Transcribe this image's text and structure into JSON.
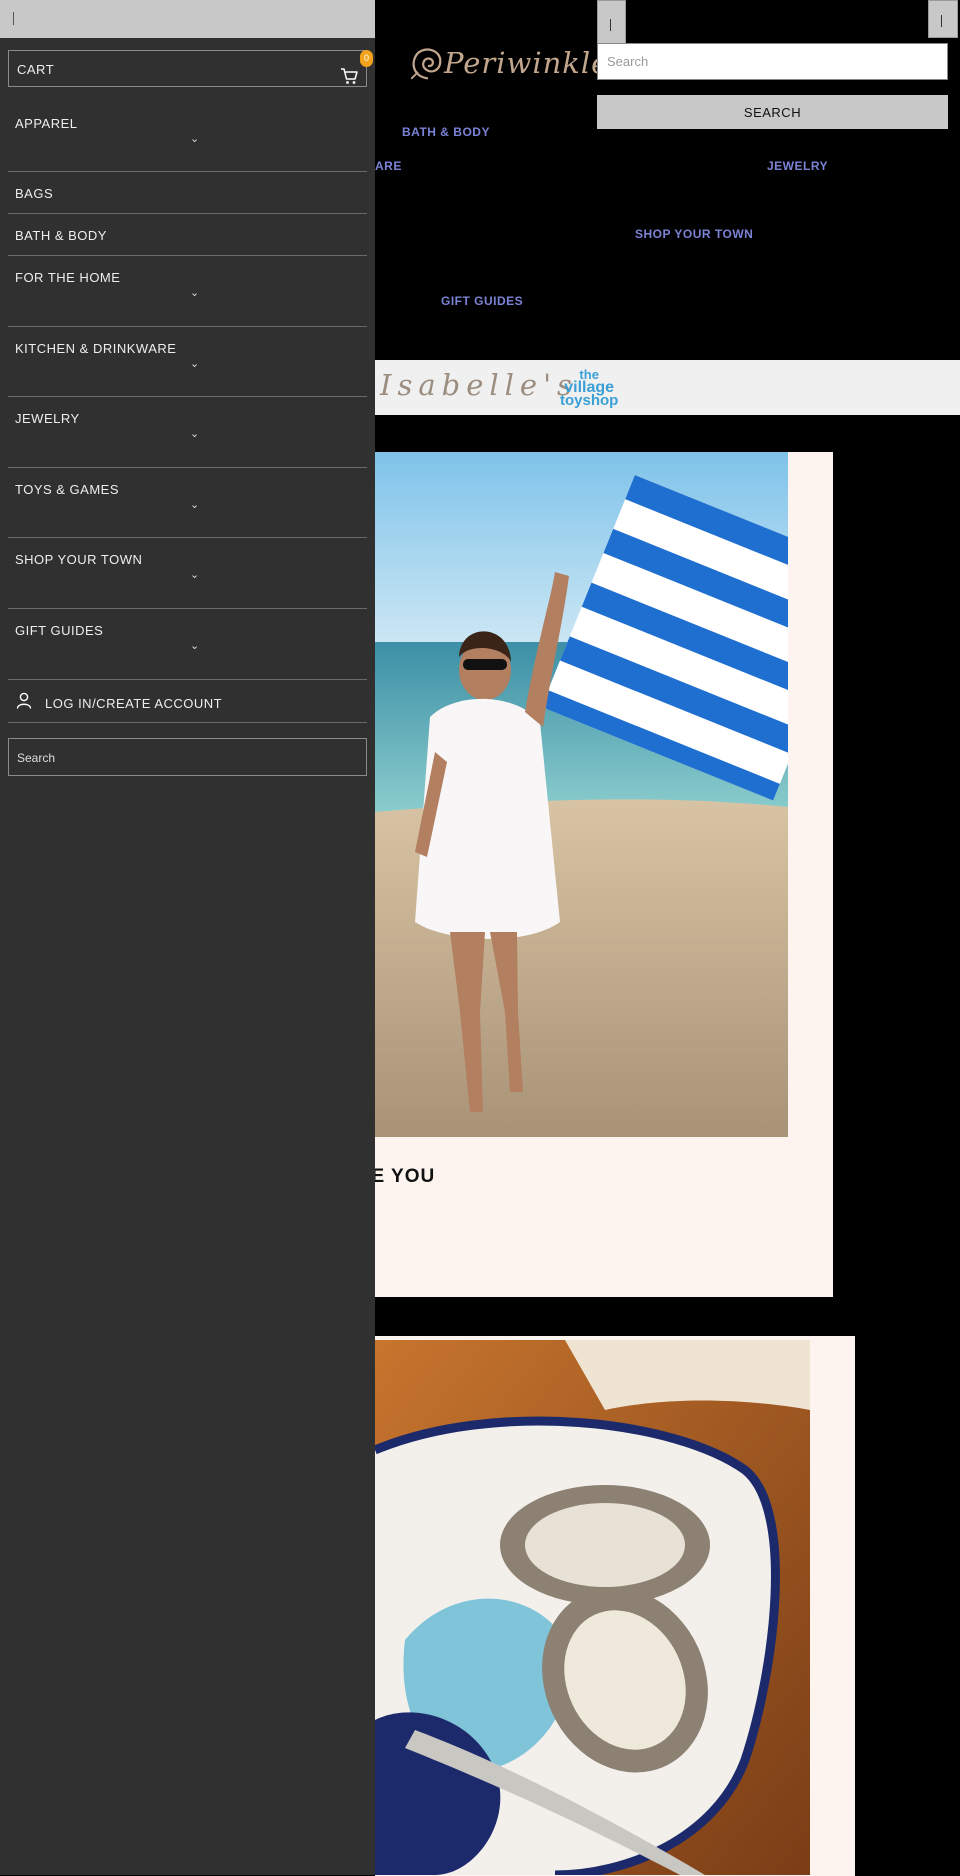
{
  "header": {
    "logo_text": "Periwinkles",
    "search_placeholder": "Search",
    "search_button": "SEARCH"
  },
  "nav": {
    "bath_body": "BATH & BODY",
    "drinkware_fragment": "ARE",
    "jewelry": "JEWELRY",
    "shop_your_town": "SHOP YOUR TOWN",
    "gift_guides": "GIFT GUIDES"
  },
  "stores_banner": {
    "isabelles": "Isabelle's",
    "toyshop_line1": "the",
    "toyshop_line2": "village",
    "toyshop_line3": "toyshop"
  },
  "feature_card": {
    "title_fragment": "OVE YOU"
  },
  "drawer": {
    "cart_label": "CART",
    "cart_count": "0",
    "menu": [
      {
        "label": "APPAREL",
        "expandable": true
      },
      {
        "label": "BAGS",
        "expandable": false
      },
      {
        "label": "BATH & BODY",
        "expandable": false
      },
      {
        "label": "FOR THE HOME",
        "expandable": true
      },
      {
        "label": "KITCHEN & DRINKWARE",
        "expandable": true
      },
      {
        "label": "JEWELRY",
        "expandable": true
      },
      {
        "label": "TOYS & GAMES",
        "expandable": true
      },
      {
        "label": "SHOP YOUR TOWN",
        "expandable": true
      },
      {
        "label": "GIFT GUIDES",
        "expandable": true
      }
    ],
    "login_label": "LOG IN/CREATE ACCOUNT",
    "search_label": "Search",
    "chevron": "⌄"
  },
  "colors": {
    "drawer_bg": "#303030",
    "nav_link": "#7b83d6",
    "badge": "#f2a21b",
    "card_bg": "#fdf4ef"
  }
}
